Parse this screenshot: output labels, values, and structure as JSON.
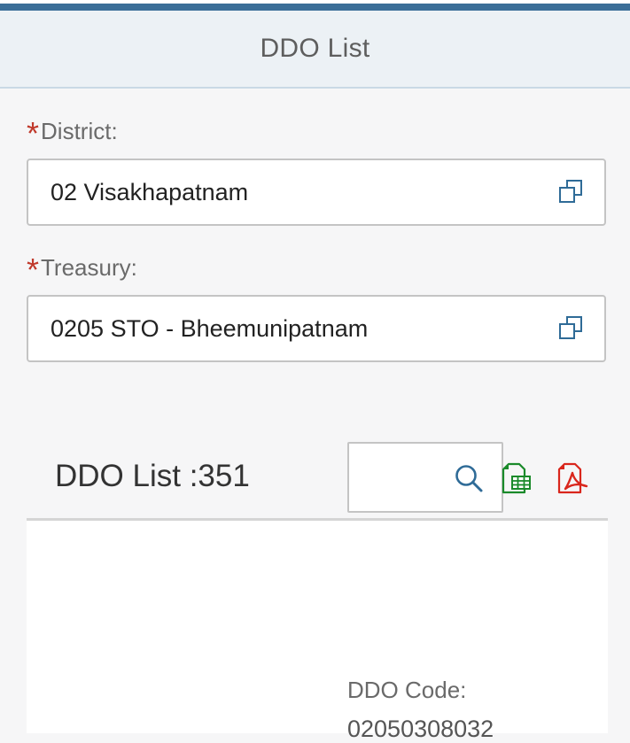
{
  "header": {
    "title": "DDO List"
  },
  "colors": {
    "accent_bar": "#3b6e98",
    "required_asterisk": "#c0392b",
    "excel_icon": "#1a8a2a",
    "pdf_icon": "#d9261c",
    "icon_blue": "#2f6b97"
  },
  "district": {
    "label": "District:",
    "required_mark": "*",
    "value": "02 Visakhapatnam",
    "icon": "value-help-icon"
  },
  "treasury": {
    "label": "Treasury:",
    "required_mark": "*",
    "value": "0205 STO - Bheemunipatnam",
    "icon": "value-help-icon"
  },
  "list": {
    "title": "DDO List :351",
    "search_value": "",
    "search_icon": "search-icon",
    "excel_icon": "excel-export-icon",
    "pdf_icon": "pdf-export-icon",
    "items": [
      {
        "ddo_code_label": "DDO Code:",
        "ddo_code_value": "02050308032"
      }
    ]
  }
}
